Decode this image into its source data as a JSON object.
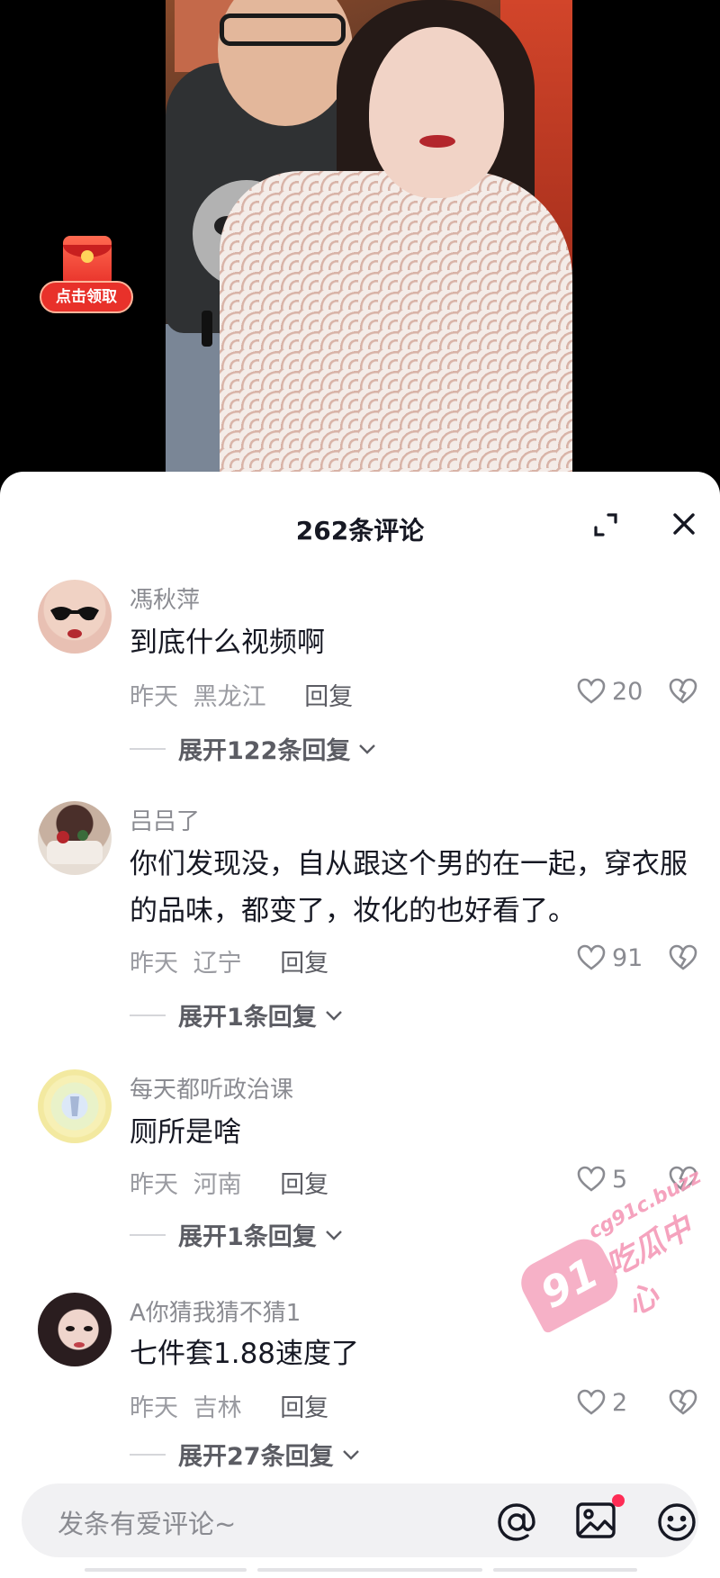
{
  "promo": {
    "label": "点击领取"
  },
  "comments_panel": {
    "title": "262条评论",
    "comments": [
      {
        "user": "馮秋萍",
        "text": "到底什么视频啊",
        "time": "昨天",
        "location": "黑龙江",
        "reply": "回复",
        "likes": "20",
        "expand": "展开122条回复"
      },
      {
        "user": "吕吕了",
        "text": "你们发现没，自从跟这个男的在一起，穿衣服的品味，都变了，妆化的也好看了。",
        "time": "昨天",
        "location": "辽宁",
        "reply": "回复",
        "likes": "91",
        "expand": "展开1条回复"
      },
      {
        "user": "每天都听政治课",
        "text": "厕所是啥",
        "time": "昨天",
        "location": "河南",
        "reply": "回复",
        "likes": "5",
        "expand": "展开1条回复"
      },
      {
        "user": "A你猜我猜不猜1",
        "text": "七件套1.88速度了",
        "time": "昨天",
        "location": "吉林",
        "reply": "回复",
        "likes": "2",
        "expand": "展开27条回复"
      }
    ]
  },
  "watermark": {
    "badge": "91",
    "url": "cg91c.buzz",
    "name": "吃瓜中心"
  },
  "input_bar": {
    "placeholder": "发条有爱评论~"
  },
  "icons": [
    "expand-icon",
    "close-icon",
    "heart-icon",
    "dislike-icon",
    "chevron-down-icon",
    "at-icon",
    "image-icon",
    "emoji-icon"
  ],
  "colors": {
    "accent": "#fe2c55",
    "text": "#161823",
    "muted": "#8a8b91",
    "promo_red": "#e8312a"
  }
}
